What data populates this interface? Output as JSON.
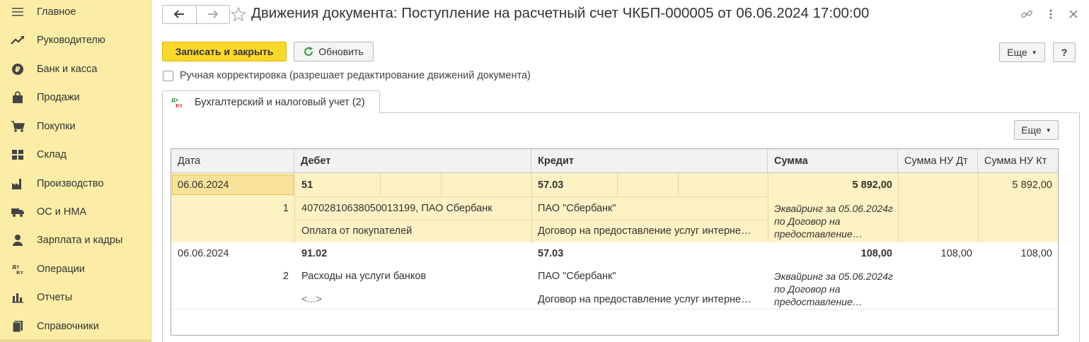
{
  "sidebar": {
    "items": [
      {
        "label": "Главное",
        "icon": "menu-icon"
      },
      {
        "label": "Руководителю",
        "icon": "trend-icon"
      },
      {
        "label": "Банк и касса",
        "icon": "ruble-coin-icon"
      },
      {
        "label": "Продажи",
        "icon": "shopping-bag-icon"
      },
      {
        "label": "Покупки",
        "icon": "cart-icon"
      },
      {
        "label": "Склад",
        "icon": "warehouse-icon"
      },
      {
        "label": "Производство",
        "icon": "factory-icon"
      },
      {
        "label": "ОС и НМА",
        "icon": "truck-icon"
      },
      {
        "label": "Зарплата и кадры",
        "icon": "person-icon"
      },
      {
        "label": "Операции",
        "icon": "dt-kt-icon"
      },
      {
        "label": "Отчеты",
        "icon": "bar-chart-icon"
      },
      {
        "label": "Справочники",
        "icon": "book-icon"
      }
    ]
  },
  "header": {
    "title": "Движения документа: Поступление на расчетный счет ЧКБП-000005 от 06.06.2024 17:00:00",
    "icons": [
      "back-arrow-icon",
      "forward-arrow-icon",
      "star-icon",
      "link-icon",
      "more-vertical-icon",
      "close-icon"
    ]
  },
  "toolbar": {
    "save_close_label": "Записать и закрыть",
    "refresh_label": "Обновить",
    "more_label": "Еще",
    "help_label": "?"
  },
  "manual_edit": {
    "label": "Ручная корректировка (разрешает редактирование движений документа)",
    "checked": false
  },
  "tab": {
    "label": "Бухгалтерский и налоговый учет (2)",
    "icon_text": "Дт Кт"
  },
  "panel": {
    "more_label": "Еще"
  },
  "table": {
    "columns": [
      "Дата",
      "Дебет",
      "Кредит",
      "Сумма",
      "Сумма НУ Дт",
      "Сумма НУ Кт"
    ],
    "rows": [
      {
        "date": "06.06.2024",
        "num": "1",
        "debit_account": "51",
        "debit_sub1": "40702810638050013199, ПАО Сбербанк",
        "debit_sub2": "Оплата от покупателей",
        "credit_account": "57.03",
        "credit_sub1": "ПАО \"Сбербанк\"",
        "credit_sub2": "Договор на предоставление услуг интерне…",
        "amount": "5 892,00",
        "content": "Эквайринг за 05.06.2024г по Договор на предоставление…",
        "nu_dt": "",
        "nu_kt": "5 892,00",
        "selected": true
      },
      {
        "date": "06.06.2024",
        "num": "2",
        "debit_account": "91.02",
        "debit_sub1": "Расходы на услуги банков",
        "debit_sub2": "<...>",
        "credit_account": "57.03",
        "credit_sub1": "ПАО \"Сбербанк\"",
        "credit_sub2": "Договор на предоставление услуг интерне…",
        "amount": "108,00",
        "content": "Эквайринг за 05.06.2024г по Договор на предоставление…",
        "nu_dt": "108,00",
        "nu_kt": "108,00",
        "selected": false
      }
    ]
  },
  "colors": {
    "sidebar_bg": "#fbeda6",
    "primary_button": "#fbd92b",
    "selected_row": "#fdf2c4",
    "refresh_icon": "#2e9e3e"
  }
}
